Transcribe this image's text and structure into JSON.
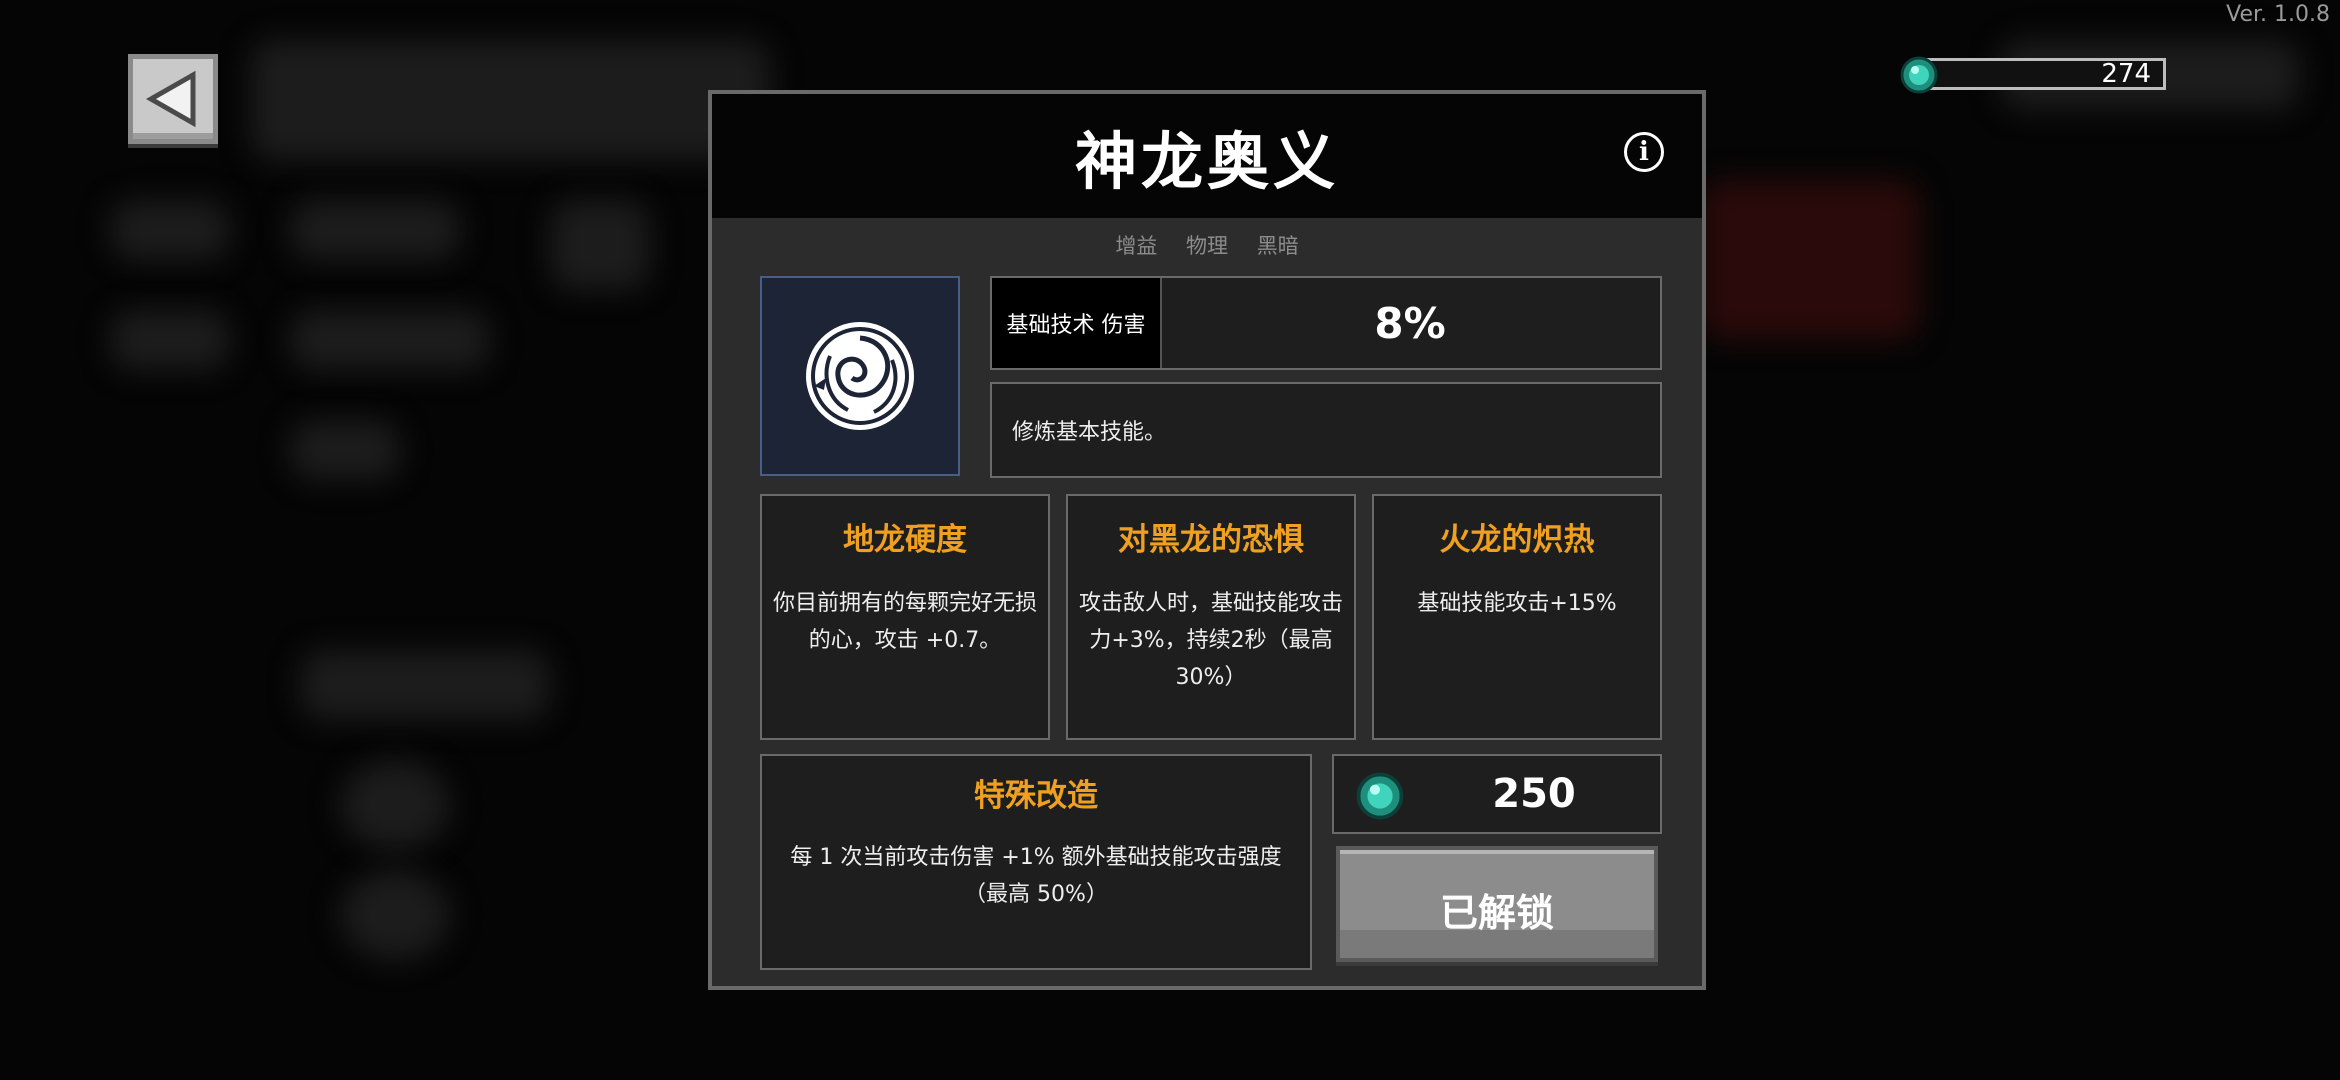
{
  "version": "Ver. 1.0.8",
  "currency": {
    "icon": "gem-icon",
    "amount": "274",
    "color": "#2bb8a2"
  },
  "modal": {
    "title": "神龙奥义",
    "tags": [
      "增益",
      "物理",
      "黑暗"
    ],
    "skill_icon": "dragon-swirl-icon",
    "stat": {
      "label": "基础技术 伤害",
      "value": "8%"
    },
    "description": "修炼基本技能。",
    "cards": [
      {
        "title": "地龙硬度",
        "text": "你目前拥有的每颗完好无损的心，攻击 +0.7。"
      },
      {
        "title": "对黑龙的恐惧",
        "text": "攻击敌人时，基础技能攻击力+3%，持续2秒（最高30%）"
      },
      {
        "title": "火龙的炽热",
        "text": "基础技能攻击+15%"
      }
    ],
    "special": {
      "title": "特殊改造",
      "text": "每 1 次当前攻击伤害 +1% 额外基础技能攻击强度（最高 50%）"
    },
    "cost": "250",
    "unlock_label": "已解锁",
    "accent_color": "#f0a020"
  }
}
